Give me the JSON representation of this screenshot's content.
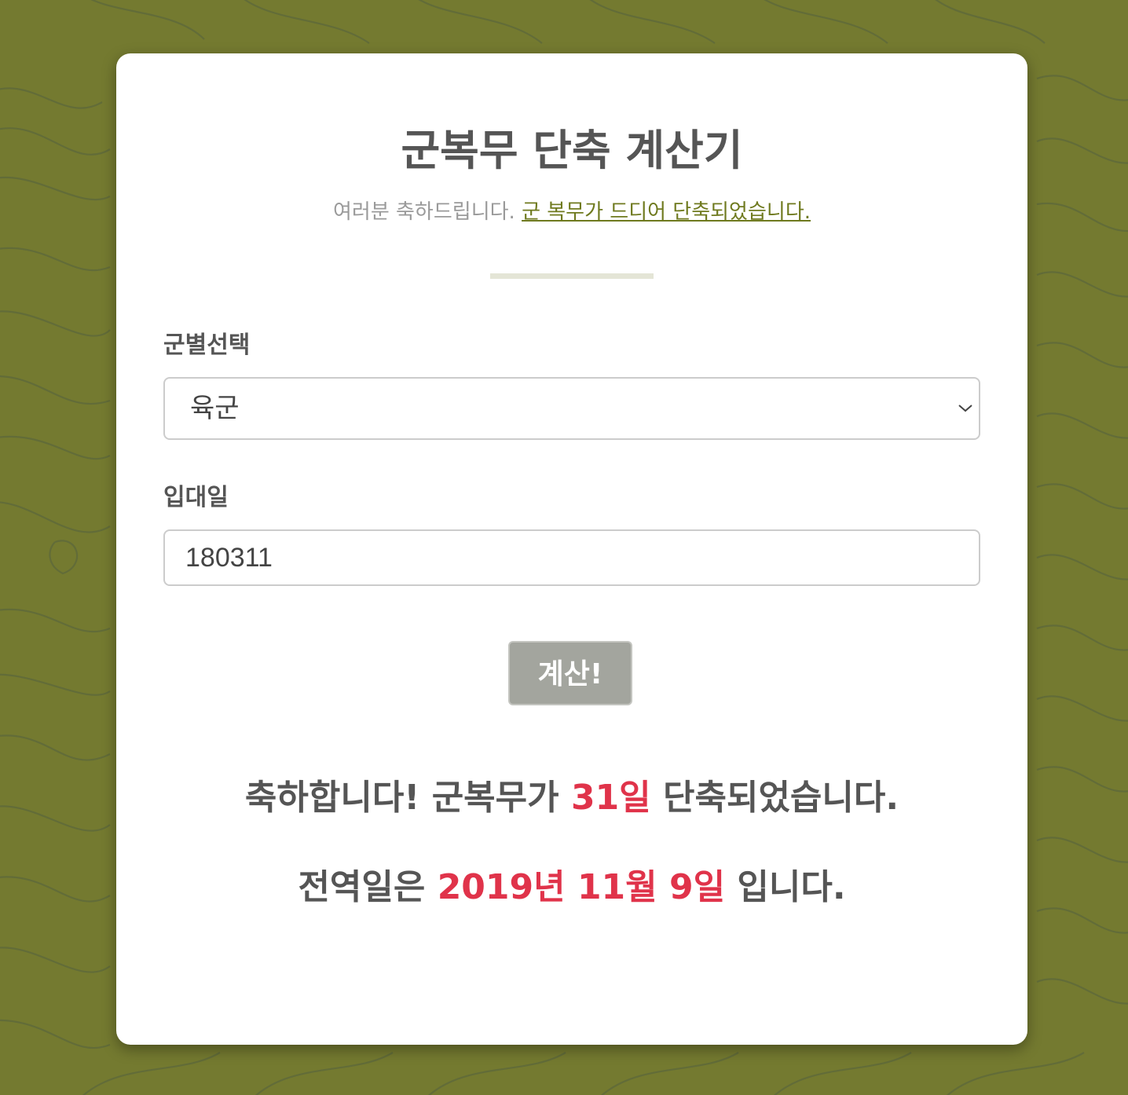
{
  "header": {
    "title": "군복무 단축 계산기",
    "subtitle_text": "여러분 축하드립니다.",
    "subtitle_link": "군 복무가 드디어 단축되었습니다."
  },
  "form": {
    "branch_label": "군별선택",
    "branch_value": "육군",
    "enlist_label": "입대일",
    "enlist_value": "180311",
    "calculate_label": "계산!"
  },
  "result": {
    "line1_prefix": "축하합니다! 군복무가",
    "line1_days": "31일",
    "line1_suffix": "단축되었습니다.",
    "line2_prefix": "전역일은",
    "line2_date": "2019년 11월 9일",
    "line2_suffix": "입니다."
  },
  "colors": {
    "background": "#747a30",
    "accent": "#6f7a1f",
    "highlight": "#e0334a",
    "button": "#a3a59e"
  }
}
